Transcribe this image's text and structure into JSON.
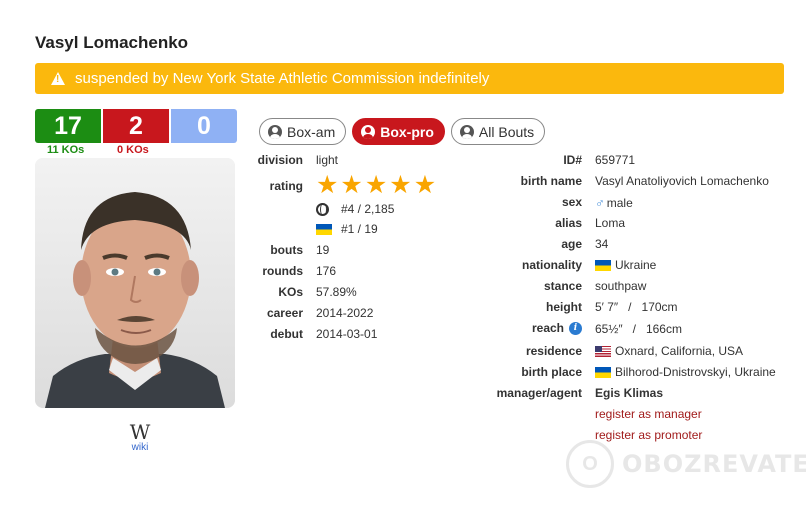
{
  "boxer_name": "Vasyl Lomachenko",
  "alert": {
    "text": "suspended by New York State Athletic Commission indefinitely",
    "icon": "warning-icon",
    "color": "#fbb80d"
  },
  "record": {
    "wins": "17",
    "losses": "2",
    "draws": "0",
    "wins_kos": "11 KOs",
    "losses_kos": "0 KOs",
    "colors": {
      "wins": "#1c8d13",
      "losses": "#c8171d",
      "draws": "#8fb1f4"
    }
  },
  "wiki": {
    "logo_text": "W",
    "label": "wiki"
  },
  "tabs": [
    {
      "label": "Box-am",
      "icon": "user-icon",
      "active": false
    },
    {
      "label": "Box-pro",
      "icon": "user-icon",
      "active": true
    },
    {
      "label": "All Bouts",
      "icon": "user-icon",
      "active": false
    }
  ],
  "left_info": {
    "division": {
      "label": "division",
      "value": "light"
    },
    "rating": {
      "label": "rating",
      "stars": 5,
      "world_rank": "#4 / 2,185",
      "country_rank": "#1 / 19"
    },
    "bouts": {
      "label": "bouts",
      "value": "19"
    },
    "rounds": {
      "label": "rounds",
      "value": "176"
    },
    "kos": {
      "label": "KOs",
      "value": "57.89%"
    },
    "career": {
      "label": "career",
      "value": "2014-2022"
    },
    "debut": {
      "label": "debut",
      "value": "2014-03-01"
    }
  },
  "right_info": {
    "id": {
      "label": "ID#",
      "value": "659771"
    },
    "birth_name": {
      "label": "birth name",
      "value": "Vasyl Anatoliyovich Lomachenko"
    },
    "sex": {
      "label": "sex",
      "value": "male",
      "icon": "male-icon"
    },
    "alias": {
      "label": "alias",
      "value": "Loma"
    },
    "age": {
      "label": "age",
      "value": "34"
    },
    "nationality": {
      "label": "nationality",
      "value": "Ukraine",
      "flag": "ukraine-flag"
    },
    "stance": {
      "label": "stance",
      "value": "southpaw"
    },
    "height": {
      "label": "height",
      "value": "5′ 7″   /   170cm"
    },
    "reach": {
      "label": "reach",
      "value": "65½″   /   166cm",
      "icon": "info-icon"
    },
    "residence": {
      "label": "residence",
      "value": "Oxnard, California, USA",
      "flag": "usa-flag"
    },
    "birth_place": {
      "label": "birth place",
      "value": "Bilhorod-Dnistrovskyi, Ukraine",
      "flag": "ukraine-flag"
    },
    "manager": {
      "label": "manager/agent",
      "value": "Egis Klimas"
    },
    "register_manager": "register as manager",
    "register_promoter": "register as promoter"
  },
  "watermark": {
    "text": "OBOZREVATEL",
    "logo": "O"
  }
}
